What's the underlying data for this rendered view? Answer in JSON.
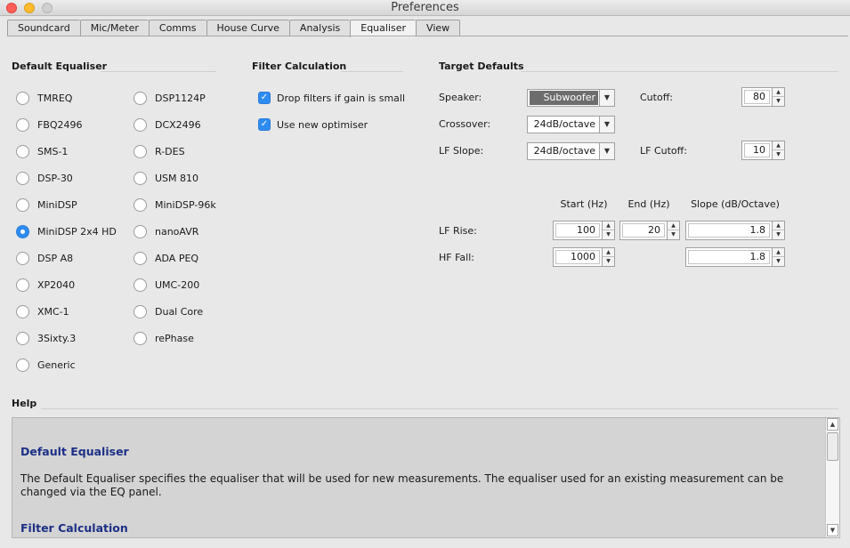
{
  "window": {
    "title": "Preferences"
  },
  "tabs": [
    "Soundcard",
    "Mic/Meter",
    "Comms",
    "House Curve",
    "Analysis",
    "Equaliser",
    "View"
  ],
  "active_tab": "Equaliser",
  "default_equaliser": {
    "title": "Default Equaliser",
    "left": [
      "TMREQ",
      "FBQ2496",
      "SMS-1",
      "DSP-30",
      "MiniDSP",
      "MiniDSP 2x4 HD",
      "DSP A8",
      "XP2040",
      "XMC-1",
      "3Sixty.3",
      "Generic"
    ],
    "right": [
      "DSP1124P",
      "DCX2496",
      "R-DES",
      "USM 810",
      "MiniDSP-96k",
      "nanoAVR",
      "ADA PEQ",
      "UMC-200",
      "Dual Core",
      "rePhase"
    ],
    "selected": "MiniDSP 2x4 HD"
  },
  "filter_calc": {
    "title": "Filter Calculation",
    "drop_filters": "Drop filters if gain is small",
    "use_optimiser": "Use new optimiser"
  },
  "target": {
    "title": "Target Defaults",
    "speaker_label": "Speaker:",
    "speaker_value": "Subwoofer",
    "crossover_label": "Crossover:",
    "crossover_value": "24dB/octave",
    "lfslope_label": "LF Slope:",
    "lfslope_value": "24dB/octave",
    "cutoff_label": "Cutoff:",
    "cutoff_value": "80",
    "lfcutoff_label": "LF Cutoff:",
    "lfcutoff_value": "10",
    "col_start": "Start (Hz)",
    "col_end": "End (Hz)",
    "col_slope": "Slope (dB/Octave)",
    "lfrise_label": "LF Rise:",
    "lfrise_start": "100",
    "lfrise_end": "20",
    "lfrise_slope": "1.8",
    "hffall_label": "HF Fall:",
    "hffall_start": "1000",
    "hffall_slope": "1.8"
  },
  "help": {
    "title": "Help",
    "h1": "Default Equaliser",
    "p1": "The Default Equaliser specifies the equaliser that will be used for new measurements. The equaliser used for an existing measurement can be changed via the EQ panel.",
    "h2": "Filter Calculation"
  }
}
